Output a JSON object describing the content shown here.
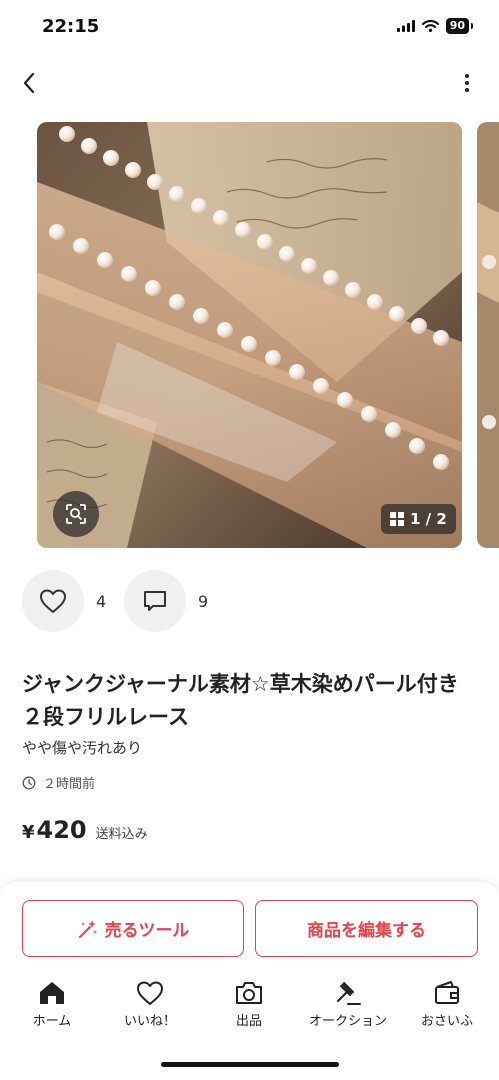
{
  "status_bar": {
    "time": "22:15",
    "battery": "90"
  },
  "gallery": {
    "page_counter": "1 / 2"
  },
  "actions": {
    "like_count": "4",
    "comment_count": "9"
  },
  "item": {
    "title": "ジャンクジャーナル素材☆草木染めパール付き２段フリルレース",
    "condition": "やや傷や汚れあり",
    "posted": "２時間前",
    "price_symbol": "¥",
    "price": "420",
    "shipping_note": "送料込み"
  },
  "buttons": {
    "sell_tool": "売るツール",
    "edit_item": "商品を編集する"
  },
  "tabs": [
    {
      "label": "ホーム",
      "icon": "home-icon"
    },
    {
      "label": "いいね！",
      "icon": "heart-icon"
    },
    {
      "label": "出品",
      "icon": "camera-icon"
    },
    {
      "label": "オークション",
      "icon": "gavel-icon"
    },
    {
      "label": "おさいふ",
      "icon": "wallet-icon"
    }
  ],
  "colors": {
    "accent": "#e8424b",
    "text": "#222222"
  }
}
